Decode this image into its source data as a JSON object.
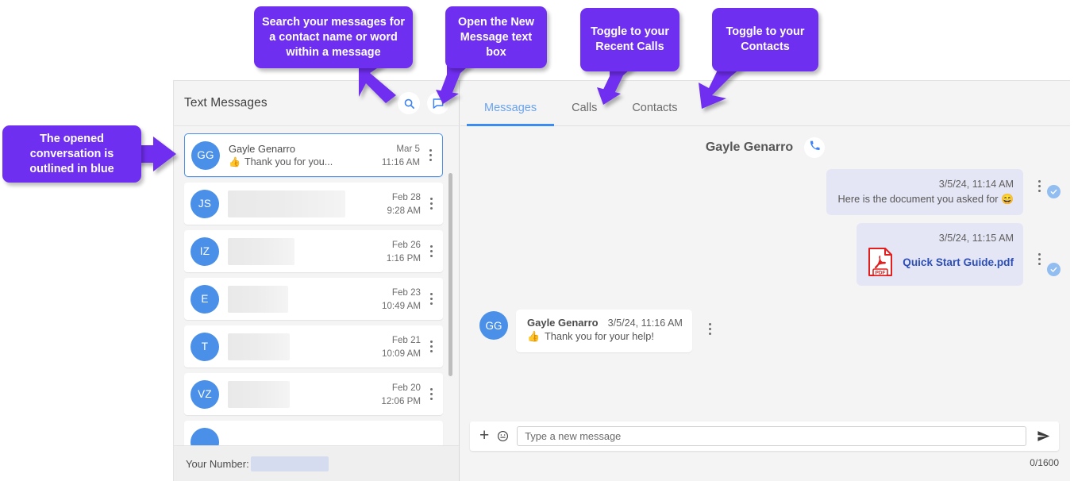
{
  "callouts": [
    {
      "id": "search",
      "text": "Search your messages for a contact name or word within a message"
    },
    {
      "id": "new-message",
      "text": "Open the New Message text box"
    },
    {
      "id": "recent-calls",
      "text": "Toggle to your Recent Calls"
    },
    {
      "id": "contacts",
      "text": "Toggle to your Contacts"
    },
    {
      "id": "opened-conversation",
      "text": "The opened conversation is outlined in blue"
    }
  ],
  "left_panel": {
    "title": "Text Messages",
    "search_icon": "search-icon",
    "new_message_icon": "new-message-icon",
    "your_number_label": "Your Number:",
    "conversations": [
      {
        "initials": "GG",
        "name": "Gayle Genarro",
        "preview": "Thank you for you...",
        "preview_emoji": "👍",
        "date": "Mar 5",
        "time": "11:16 AM",
        "selected": true,
        "redacted": false
      },
      {
        "initials": "JS",
        "name": "",
        "preview": "",
        "date": "Feb 28",
        "time": "9:28 AM",
        "selected": false,
        "redacted": true
      },
      {
        "initials": "IZ",
        "name": "",
        "preview": "",
        "date": "Feb 26",
        "time": "1:16 PM",
        "selected": false,
        "redacted": true
      },
      {
        "initials": "E",
        "name": "",
        "preview": "",
        "date": "Feb 23",
        "time": "10:49 AM",
        "selected": false,
        "redacted": true
      },
      {
        "initials": "T",
        "name": "",
        "preview": "",
        "date": "Feb 21",
        "time": "10:09 AM",
        "selected": false,
        "redacted": true
      },
      {
        "initials": "VZ",
        "name": "",
        "preview": "",
        "date": "Feb 20",
        "time": "12:06 PM",
        "selected": false,
        "redacted": true
      }
    ]
  },
  "right_panel": {
    "tabs": [
      {
        "label": "Messages",
        "active": true
      },
      {
        "label": "Calls",
        "active": false
      },
      {
        "label": "Contacts",
        "active": false
      }
    ],
    "thread_contact": "Gayle Genarro",
    "call_icon": "phone-icon",
    "messages": [
      {
        "direction": "out",
        "timestamp": "3/5/24, 11:14 AM",
        "text": "Here is the document you asked for 😄",
        "delivered": true
      },
      {
        "direction": "out",
        "timestamp": "3/5/24, 11:15 AM",
        "attachment": "Quick Start Guide.pdf",
        "attachment_type": "PDF",
        "delivered": true
      },
      {
        "direction": "in",
        "sender_initials": "GG",
        "sender": "Gayle Genarro",
        "timestamp": "3/5/24, 11:16 AM",
        "emoji": "👍",
        "text": "Thank you for your help!"
      }
    ],
    "composer": {
      "add_icon": "plus-icon",
      "emoji_icon": "emoji-icon",
      "placeholder": "Type a new message",
      "value": "",
      "send_icon": "send-icon",
      "char_count": "0/1600"
    }
  },
  "colors": {
    "callout_purple": "#6f2ff0",
    "selected_outline_blue": "#4a90e8",
    "tab_active_blue": "#3c8bf0",
    "avatar_blue": "#4a90e8",
    "bubble_out": "#e5e6f5",
    "pdf_red": "#e02020",
    "file_link_blue": "#2c4fb8"
  }
}
